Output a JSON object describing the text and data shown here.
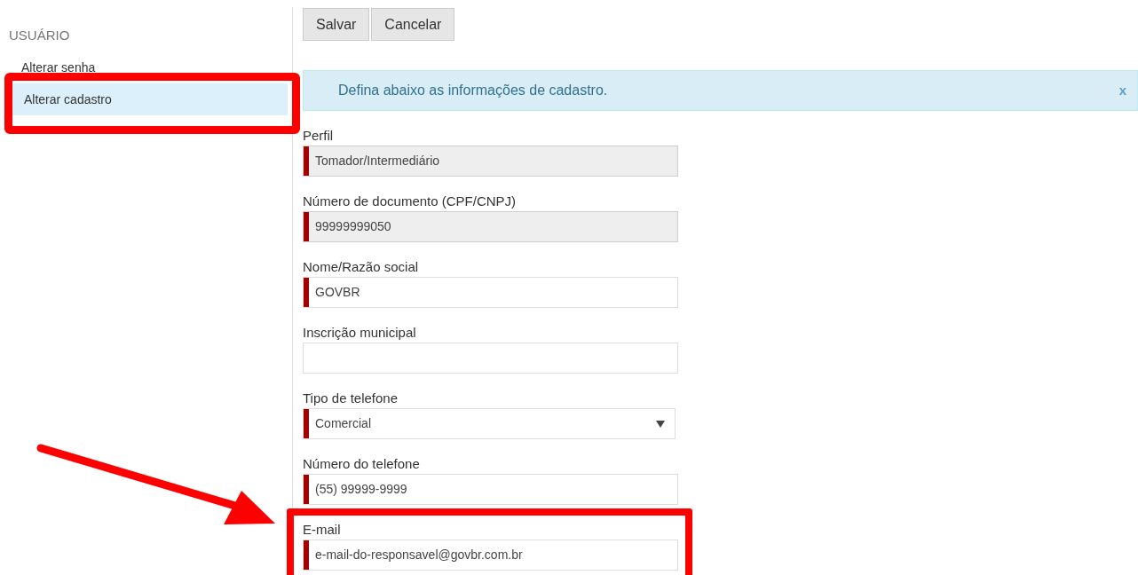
{
  "sidebar": {
    "heading": "USUÁRIO",
    "items": [
      {
        "label": "Alterar senha",
        "selected": false
      },
      {
        "label": "Alterar cadastro",
        "selected": true
      }
    ]
  },
  "buttons": [
    "Salvar",
    "Cancelar"
  ],
  "alert": {
    "message": "Defina abaixo as informações de cadastro.",
    "close": "x"
  },
  "fields": [
    {
      "kind": "text",
      "label": "Perfil",
      "value": "Tomador/Intermediário",
      "required": true,
      "disabled": true
    },
    {
      "kind": "text",
      "label": "Número de documento (CPF/CNPJ)",
      "value": "99999999050",
      "required": true,
      "disabled": true
    },
    {
      "kind": "text",
      "label": "Nome/Razão social",
      "value": "GOVBR",
      "required": true,
      "disabled": false
    },
    {
      "kind": "text",
      "label": "Inscrição municipal",
      "required": false,
      "disabled": false
    },
    {
      "kind": "select",
      "label": "Tipo de telefone",
      "value": "Comercial",
      "required": true,
      "disabled": false
    },
    {
      "kind": "text",
      "label": "Número do telefone",
      "value": "(55) 99999-9999",
      "required": true,
      "disabled": false
    },
    {
      "kind": "text",
      "label": "E-mail",
      "value": "e-mail-do-responsavel@govbr.com.br",
      "required": true,
      "disabled": false
    }
  ]
}
